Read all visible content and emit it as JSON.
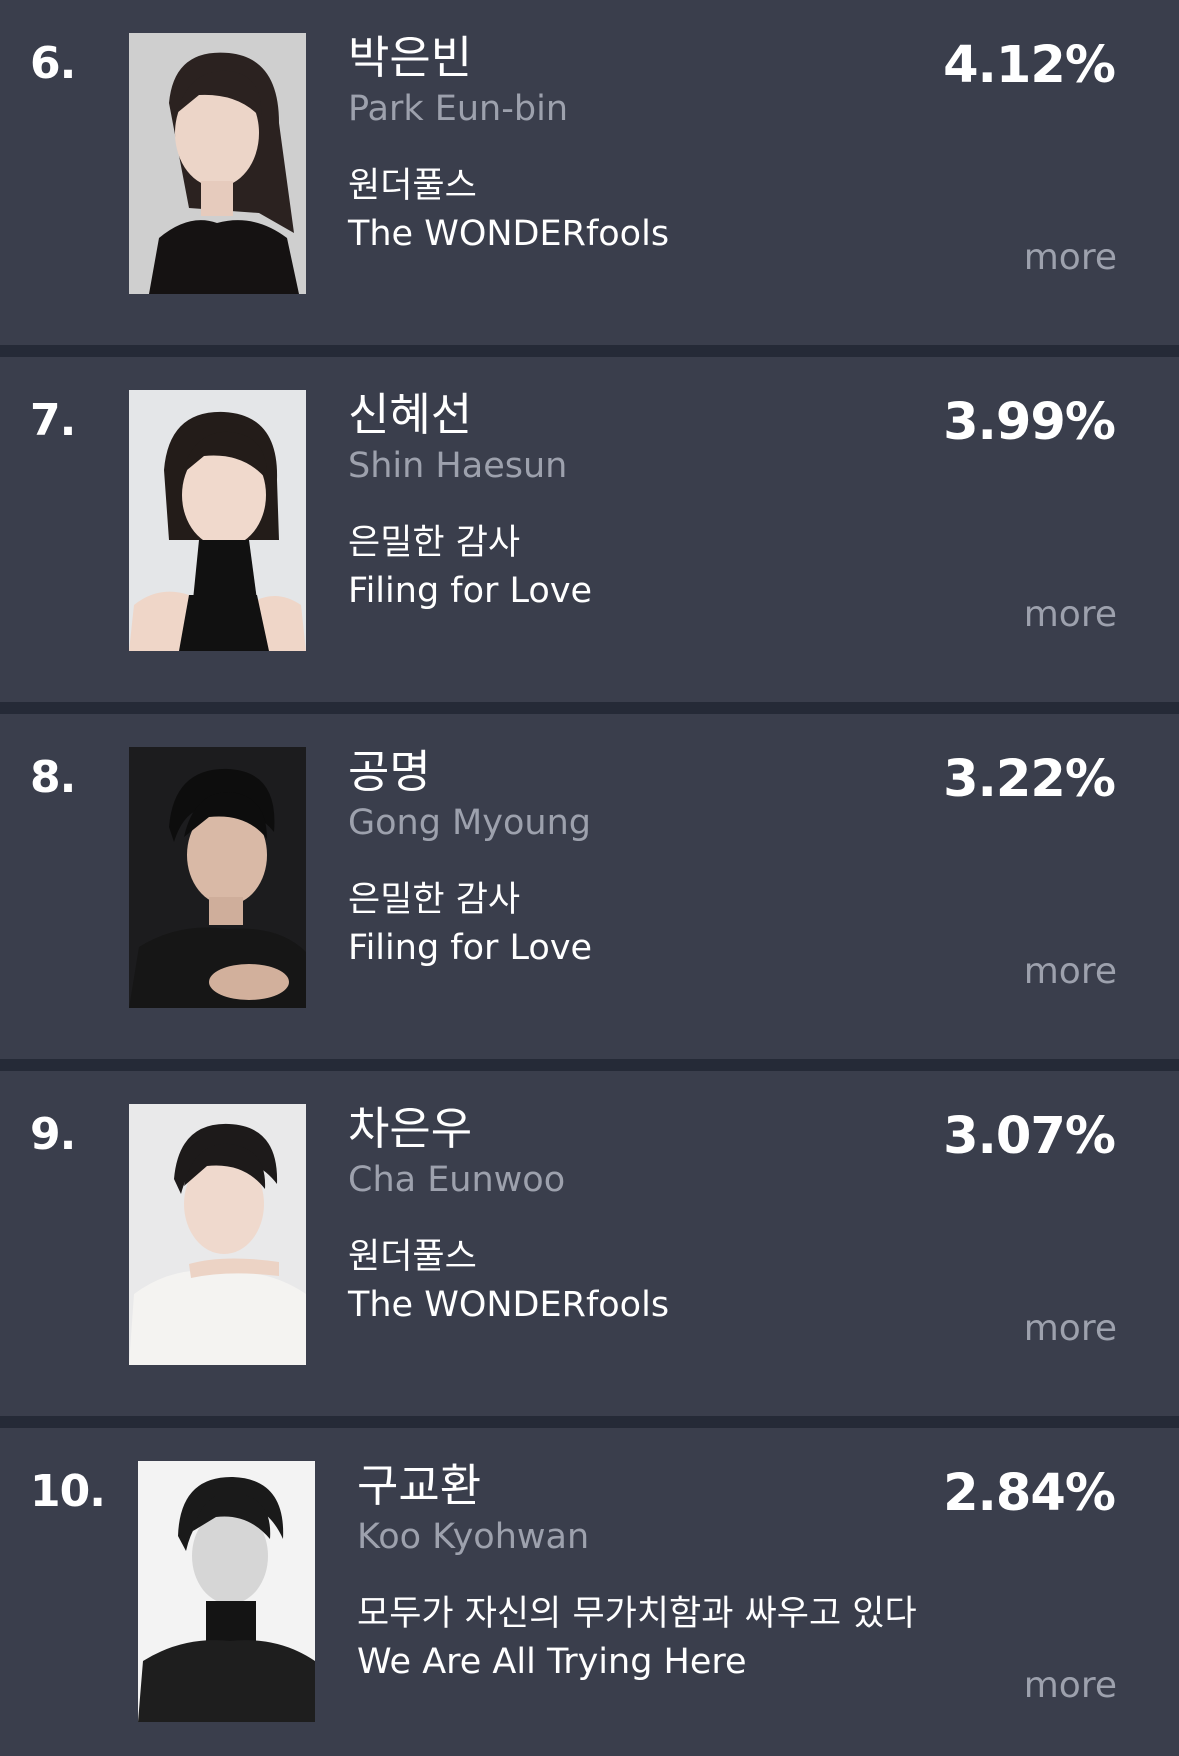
{
  "rankings": [
    {
      "rank": "6.",
      "name_ko": "박은빈",
      "name_en": "Park Eun-bin",
      "show_ko": "원더풀스",
      "show_en": "The WONDERfools",
      "percent": "4.12%",
      "more": "more"
    },
    {
      "rank": "7.",
      "name_ko": "신혜선",
      "name_en": "Shin Haesun",
      "show_ko": "은밀한 감사",
      "show_en": "Filing for Love",
      "percent": "3.99%",
      "more": "more"
    },
    {
      "rank": "8.",
      "name_ko": "공명",
      "name_en": "Gong Myoung",
      "show_ko": "은밀한 감사",
      "show_en": "Filing for Love",
      "percent": "3.22%",
      "more": "more"
    },
    {
      "rank": "9.",
      "name_ko": "차은우",
      "name_en": "Cha Eunwoo",
      "show_ko": "원더풀스",
      "show_en": "The WONDERfools",
      "percent": "3.07%",
      "more": "more"
    },
    {
      "rank": "10.",
      "name_ko": "구교환",
      "name_en": "Koo Kyohwan",
      "show_ko": "모두가 자신의 무가치함과 싸우고 있다",
      "show_en": "We Are All Trying Here",
      "percent": "2.84%",
      "more": "more"
    }
  ],
  "colors": {
    "card_background": "#3a3e4c",
    "divider": "#252a37",
    "primary_text": "#ffffff",
    "secondary_text": "#9da1ad"
  }
}
